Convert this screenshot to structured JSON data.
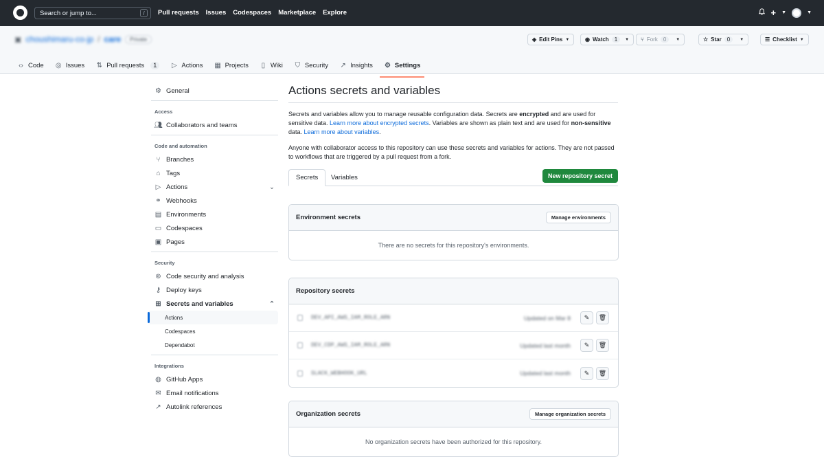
{
  "topbar": {
    "search_placeholder": "Search or jump to...",
    "search_hotkey": "/",
    "nav": [
      "Pull requests",
      "Issues",
      "Codespaces",
      "Marketplace",
      "Explore"
    ]
  },
  "repo": {
    "owner": "choushimaru-co-jp",
    "separator": "/",
    "name": "care",
    "visibility": "Private",
    "edit_pins": "Edit Pins",
    "watch_label": "Watch",
    "watch_count": "1",
    "fork_label": "Fork",
    "fork_count": "0",
    "star_label": "Star",
    "star_count": "0",
    "checklist_label": "Checklist"
  },
  "tabs": [
    {
      "label": "Code"
    },
    {
      "label": "Issues"
    },
    {
      "label": "Pull requests",
      "count": "1"
    },
    {
      "label": "Actions"
    },
    {
      "label": "Projects"
    },
    {
      "label": "Wiki"
    },
    {
      "label": "Security"
    },
    {
      "label": "Insights"
    },
    {
      "label": "Settings"
    }
  ],
  "sidebar": {
    "general": "General",
    "access_heading": "Access",
    "collaborators": "Collaborators and teams",
    "code_heading": "Code and automation",
    "branches": "Branches",
    "tags": "Tags",
    "actions": "Actions",
    "webhooks": "Webhooks",
    "environments": "Environments",
    "codespaces": "Codespaces",
    "pages": "Pages",
    "security_heading": "Security",
    "code_security": "Code security and analysis",
    "deploy_keys": "Deploy keys",
    "secrets": "Secrets and variables",
    "sub_actions": "Actions",
    "sub_codespaces": "Codespaces",
    "sub_dependabot": "Dependabot",
    "integrations_heading": "Integrations",
    "github_apps": "GitHub Apps",
    "email_notifications": "Email notifications",
    "autolink": "Autolink references"
  },
  "main": {
    "title": "Actions secrets and variables",
    "p1_a": "Secrets and variables allow you to manage reusable configuration data. Secrets are ",
    "p1_b": "encrypted",
    "p1_c": " and are used for sensitive data. ",
    "p1_link1": "Learn more about encrypted secrets",
    "p1_d": ". Variables are shown as plain text and are used for ",
    "p1_e": "non-sensitive",
    "p1_f": " data. ",
    "p1_link2": "Learn more about variables",
    "p1_g": ".",
    "p2": "Anyone with collaborator access to this repository can use these secrets and variables for actions. They are not passed to workflows that are triggered by a pull request from a fork.",
    "tab_secrets": "Secrets",
    "tab_variables": "Variables",
    "new_secret": "New repository secret"
  },
  "env_box": {
    "title": "Environment secrets",
    "button": "Manage environments",
    "empty": "There are no secrets for this repository's environments."
  },
  "repo_box": {
    "title": "Repository secrets",
    "rows": [
      {
        "name": "DEV_API_AWS_IAM_ROLE_ARN",
        "updated": "Updated on Mar 8"
      },
      {
        "name": "DEV_CDP_AWS_IAM_ROLE_ARN",
        "updated": "Updated last month"
      },
      {
        "name": "SLACK_WEBHOOK_URL",
        "updated": "Updated last month"
      }
    ]
  },
  "org_box": {
    "title": "Organization secrets",
    "button": "Manage organization secrets",
    "empty": "No organization secrets have been authorized for this repository."
  },
  "colors": {
    "accent": "#0969da",
    "green": "#1f883d",
    "topbar": "#24292f",
    "tab_underline": "#fd8c73"
  }
}
